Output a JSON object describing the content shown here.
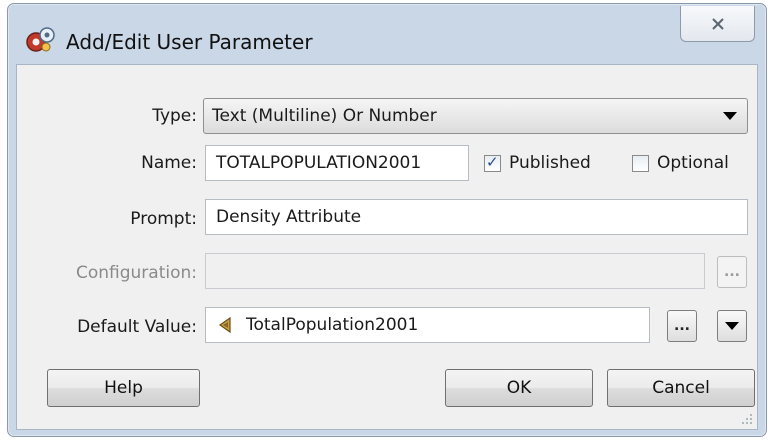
{
  "window": {
    "title": "Add/Edit User Parameter",
    "close_glyph": "X"
  },
  "form": {
    "type_label": "Type:",
    "type_value": "Text (Multiline) Or Number",
    "name_label": "Name:",
    "name_value": "TOTALPOPULATION2001",
    "published_label": "Published",
    "published_checked": true,
    "optional_label": "Optional",
    "optional_checked": false,
    "prompt_label": "Prompt:",
    "prompt_value": "Density Attribute",
    "configuration_label": "Configuration:",
    "configuration_value": "",
    "configuration_button": "...",
    "default_label": "Default Value:",
    "default_value": "TotalPopulation2001",
    "default_button": "..."
  },
  "buttons": {
    "help": "Help",
    "ok": "OK",
    "cancel": "Cancel"
  },
  "icons": {
    "title": "app-gears-icon",
    "attribute": "attribute-value-icon",
    "dropdown": "chevron-down-icon"
  }
}
